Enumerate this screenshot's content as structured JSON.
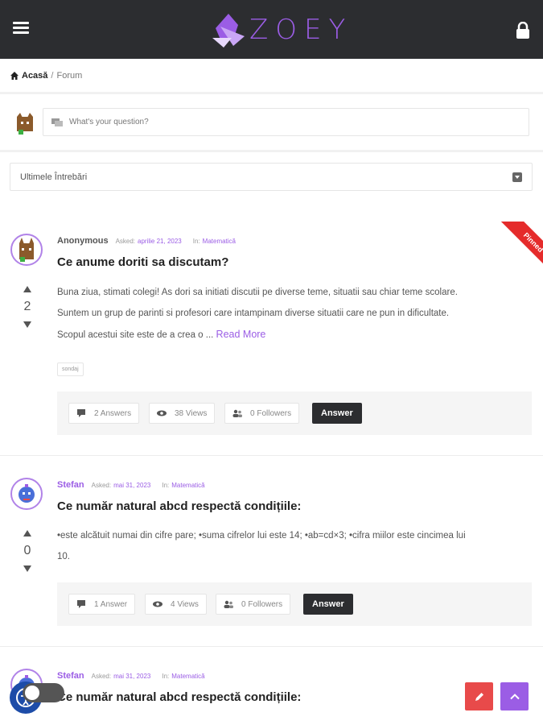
{
  "header": {
    "logo_text": "ZOEY",
    "brand_color": "#9b5de5",
    "menu_icon": "menu-icon",
    "lock_icon": "lock-icon"
  },
  "breadcrumb": {
    "home": "Acasă",
    "separator": "/",
    "current": "Forum"
  },
  "ask": {
    "placeholder": "What's your question?"
  },
  "filter": {
    "selected": "Ultimele Întrebări"
  },
  "questions": [
    {
      "author": "Anonymous",
      "asked_label": "Asked:",
      "date": "aprilie 21, 2023",
      "in_label": "In:",
      "category": "Matematică",
      "title": "Ce anume doriti sa discutam?",
      "votes": "2",
      "body": [
        "Buna ziua, stimati colegi! As dori sa initiati discutii pe diverse teme, situatii sau chiar teme scolare.",
        "Suntem un grup de parinti si profesori care intampinam diverse situatii care ne pun in dificultate.",
        "Scopul acestui site este de a crea o ..."
      ],
      "read_more": "Read More",
      "tag": "sondaj",
      "pinned": "Pinned",
      "answers": "2 Answers",
      "views": "38 Views",
      "followers": "0 Followers",
      "answer_button": "Answer"
    },
    {
      "author": "Stefan",
      "asked_label": "Asked:",
      "date": "mai 31, 2023",
      "in_label": "In:",
      "category": "Matematică",
      "title": "Ce număr natural abcd respectă condițiile:",
      "votes": "0",
      "body": [
        "•este alcătuit numai din cifre pare; •suma cifrelor lui este 14; •ab=cd×3; •cifra miilor este cincimea lui",
        "10."
      ],
      "answers": "1 Answer",
      "views": "4 Views",
      "followers": "0 Followers",
      "answer_button": "Answer"
    },
    {
      "author": "Stefan",
      "asked_label": "Asked:",
      "date": "mai 31, 2023",
      "in_label": "In:",
      "category": "Matematică",
      "title": "Ce număr natural abcd respectă condițiile:"
    }
  ],
  "fabs": {
    "edit_icon": "pencil-icon",
    "top_icon": "chevron-up-icon"
  }
}
